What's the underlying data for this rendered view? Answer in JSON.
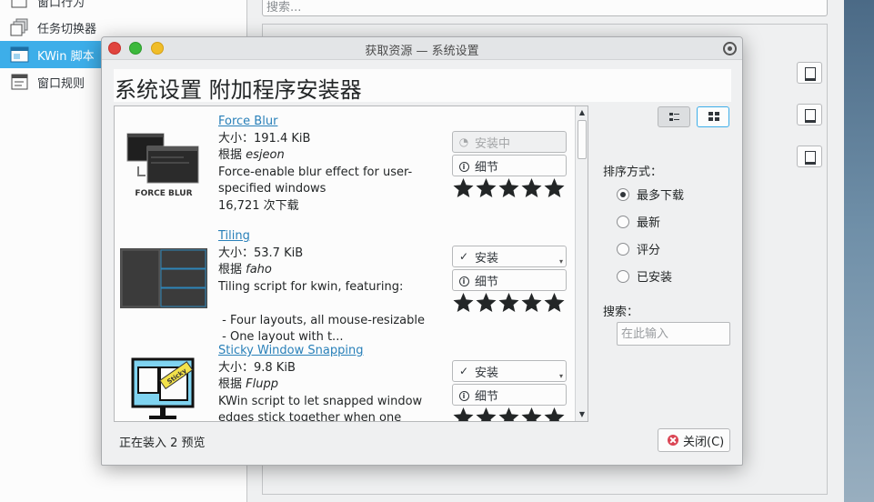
{
  "background": {
    "sidebar_items": [
      {
        "label": "窗口行为"
      },
      {
        "label": "任务切换器"
      },
      {
        "label": "KWin 脚本"
      },
      {
        "label": "窗口规则"
      }
    ],
    "search_placeholder": "搜索..."
  },
  "dialog": {
    "title": "获取资源 — 系统设置",
    "heading": "系统设置 附加程序安装器",
    "items": [
      {
        "name": "Force Blur",
        "size": "大小：191.4 KiB",
        "author_prefix": "根据 ",
        "author": "esjeon",
        "desc": [
          "Force-enable blur effect for user-",
          "specified windows"
        ],
        "downloads": "16,721 次下载",
        "thumb_caption": "FORCE BLUR",
        "install_label": "安装中",
        "details_label": "细节",
        "rating": 5
      },
      {
        "name": "Tiling",
        "size": "大小：53.7 KiB",
        "author_prefix": "根据 ",
        "author": "faho",
        "desc": [
          "Tiling script for kwin, featuring:",
          "",
          " - Four layouts, all mouse-resizable",
          " - One layout with t..."
        ],
        "install_label": "安装",
        "details_label": "细节",
        "rating": 5
      },
      {
        "name": "Sticky Window Snapping",
        "size": "大小：9.8 KiB",
        "author_prefix": "根据 ",
        "author": "Flupp",
        "desc": [
          "KWin script to let snapped window",
          "edges stick together when one"
        ],
        "thumb_caption": "Sticky",
        "install_label": "安装",
        "details_label": "细节",
        "rating": 5
      }
    ],
    "sort_label": "排序方式：",
    "sort_options": [
      {
        "label": "最多下载",
        "checked": true
      },
      {
        "label": "最新",
        "checked": false
      },
      {
        "label": "评分",
        "checked": false
      },
      {
        "label": "已安装",
        "checked": false
      }
    ],
    "search_label": "搜索：",
    "search_placeholder": "在此输入",
    "status": "正在装入 2 预览",
    "close_label": "关闭(C)"
  }
}
